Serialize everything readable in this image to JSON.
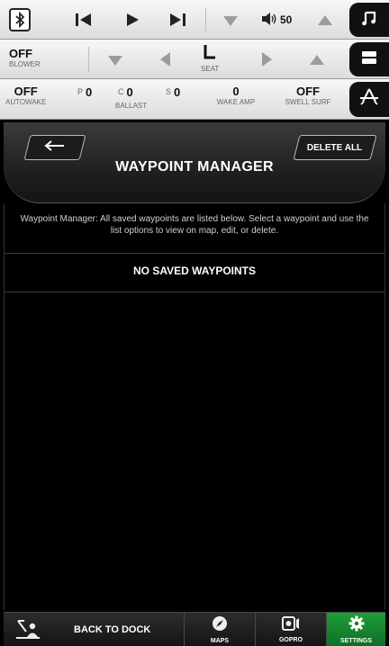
{
  "media": {
    "volume_value": "50",
    "icons": [
      "bluetooth-icon",
      "previous-track-icon",
      "play-icon",
      "next-track-icon",
      "volume-down-icon",
      "speaker-icon",
      "volume-up-icon",
      "music-note-icon"
    ]
  },
  "climate": {
    "blower_value": "OFF",
    "blower_label": "BLOWER",
    "seat_label": "SEAT",
    "icons": [
      "blower-down-icon",
      "seat-left-icon",
      "seat-icon",
      "seat-right-icon",
      "blower-up-icon",
      "panel-icon"
    ]
  },
  "wake": {
    "autowake_value": "OFF",
    "autowake_label": "AUTOWAKE",
    "ballast_p_prefix": "P",
    "ballast_p_value": "0",
    "ballast_c_prefix": "C",
    "ballast_c_value": "0",
    "ballast_s_prefix": "S",
    "ballast_s_value": "0",
    "ballast_label": "BALLAST",
    "wake_amp_value": "0",
    "wake_amp_label": "WAKE AMP",
    "swell_surf_value": "OFF",
    "swell_surf_label": "SWELL SURF",
    "icons": [
      "wake-wave-icon"
    ]
  },
  "header": {
    "title": "WAYPOINT MANAGER",
    "delete_all_label": "DELETE ALL",
    "icons": [
      "back-arrow-icon"
    ]
  },
  "content": {
    "description": "Waypoint Manager: All saved waypoints are listed below.  Select a waypoint and use the list options to view on map, edit, or delete.",
    "empty_message": "NO SAVED WAYPOINTS"
  },
  "bottom_nav": {
    "back_to_dock_label": "BACK TO DOCK",
    "maps_label": "MAPS",
    "gopro_label": "GOPRO",
    "settings_label": "SETTINGS",
    "active_color": "#1a8f33",
    "icons": [
      "dock-icon",
      "compass-icon",
      "camera-icon",
      "gear-icon"
    ]
  }
}
